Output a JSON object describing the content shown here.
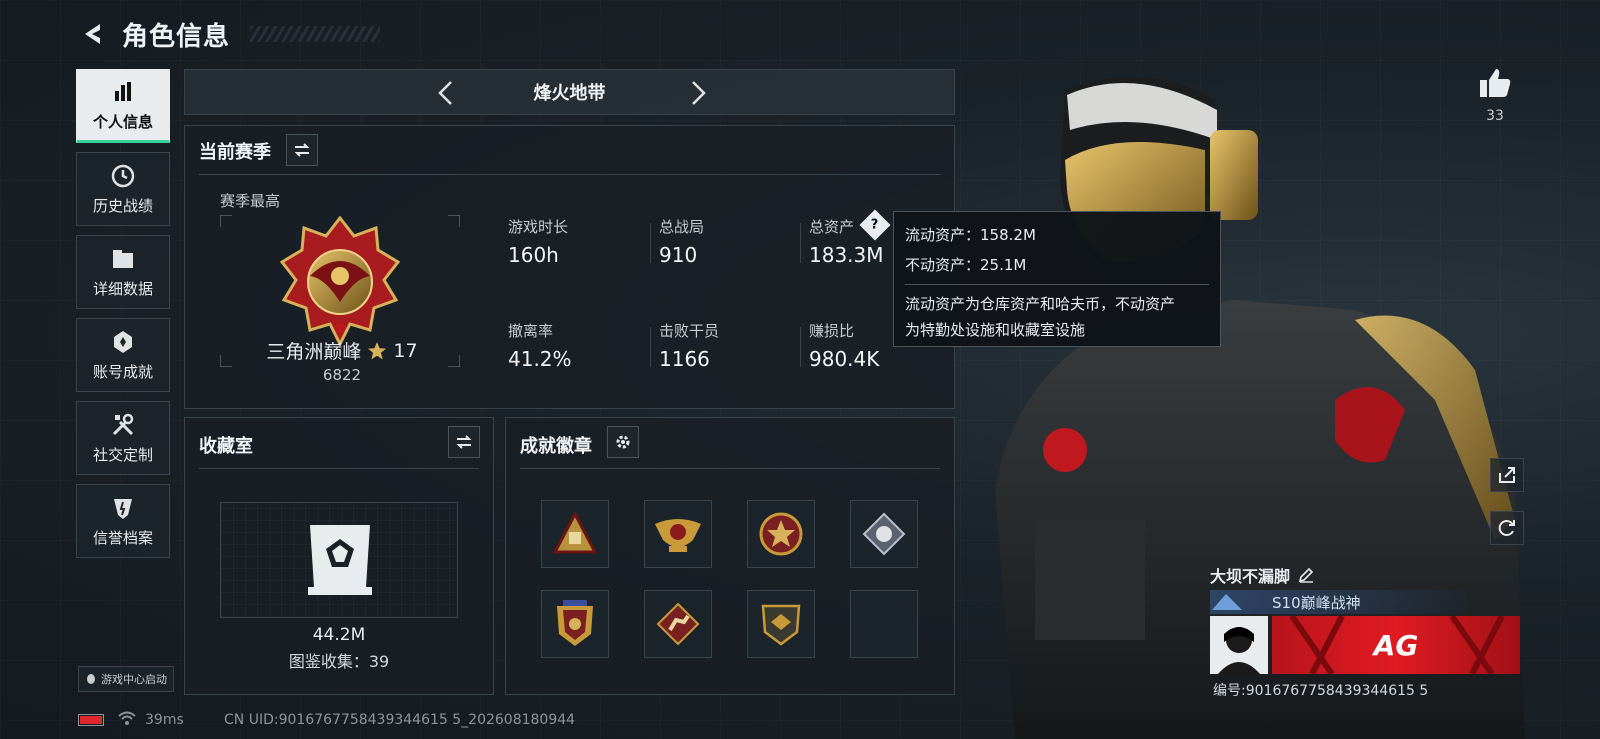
{
  "header": {
    "title": "角色信息"
  },
  "sidebar": {
    "items": [
      {
        "label": "个人信息",
        "icon": "bar-chart-icon",
        "active": true
      },
      {
        "label": "历史战绩",
        "icon": "clock-icon"
      },
      {
        "label": "详细数据",
        "icon": "folder-icon"
      },
      {
        "label": "账号成就",
        "icon": "achievement-icon"
      },
      {
        "label": "社交定制",
        "icon": "tools-icon"
      },
      {
        "label": "信誉档案",
        "icon": "shield-icon"
      }
    ],
    "game_center_label": "游戏中心启动"
  },
  "mode": {
    "name": "烽火地带"
  },
  "season": {
    "title": "当前赛季",
    "best_label": "赛季最高",
    "rank_name": "三角洲巅峰",
    "rank_stars": "17",
    "rank_score": "6822",
    "stats": [
      {
        "label": "游戏时长",
        "value": "160h"
      },
      {
        "label": "总战局",
        "value": "910"
      },
      {
        "label": "总资产",
        "value": "183.3M"
      },
      {
        "label": "撤离率",
        "value": "41.2%"
      },
      {
        "label": "击败干员",
        "value": "1166"
      },
      {
        "label": "赚损比",
        "value": "980.4K"
      }
    ]
  },
  "tooltip": {
    "line1": "流动资产：158.2M",
    "line2": "不动资产：25.1M",
    "desc1": "流动资产为仓库资产和哈夫币，不动资产",
    "desc2": "为特勤处设施和收藏室设施"
  },
  "collection": {
    "title": "收藏室",
    "value": "44.2M",
    "catalog": "图鉴收集：39"
  },
  "badges": {
    "title": "成就徽章",
    "items": [
      "triangle-badge-icon",
      "eagle-badge-icon",
      "star-medal-icon",
      "diamond-badge-icon",
      "shield-emblem-icon",
      "runner-badge-icon",
      "wing-shield-icon",
      "empty-slot"
    ]
  },
  "profile": {
    "likes": "33",
    "name": "大坝不漏脚",
    "title": "S10巅峰战神",
    "id_text": "编号:9016767758439344615 5",
    "team_logo": "AG"
  },
  "status": {
    "ping": "39ms",
    "uid": "CN UID:9016767758439344615 5_202608180944"
  },
  "colors": {
    "accent": "#35d39a",
    "battery": "#e0262a",
    "team_red": "#d81b22"
  }
}
